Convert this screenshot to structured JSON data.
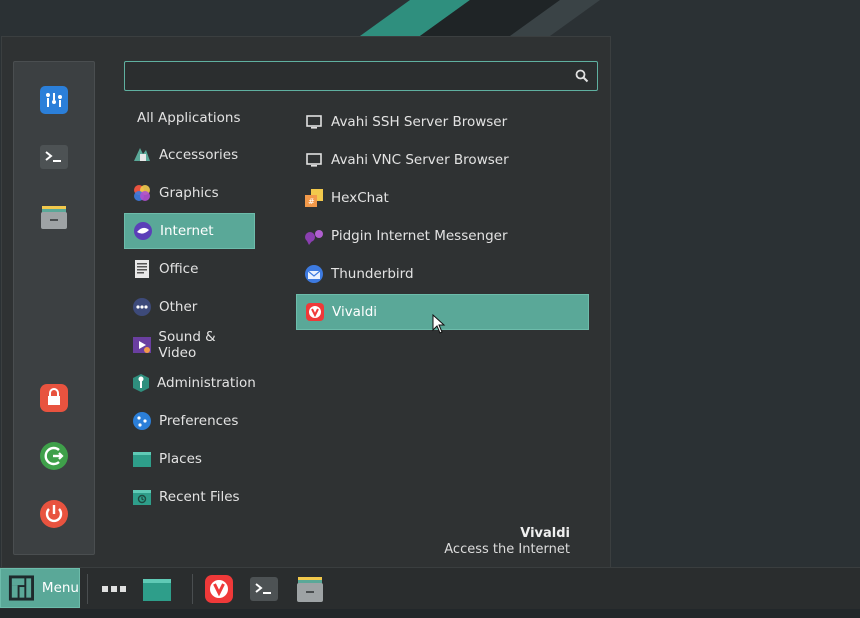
{
  "search": {
    "value": "",
    "placeholder": ""
  },
  "categories": [
    {
      "label": "All Applications"
    },
    {
      "label": "Accessories"
    },
    {
      "label": "Graphics"
    },
    {
      "label": "Internet"
    },
    {
      "label": "Office"
    },
    {
      "label": "Other"
    },
    {
      "label": "Sound & Video"
    },
    {
      "label": "Administration"
    },
    {
      "label": "Preferences"
    },
    {
      "label": "Places"
    },
    {
      "label": "Recent Files"
    }
  ],
  "apps": [
    {
      "label": "Avahi SSH Server Browser"
    },
    {
      "label": "Avahi VNC Server Browser"
    },
    {
      "label": "HexChat"
    },
    {
      "label": "Pidgin Internet Messenger"
    },
    {
      "label": "Thunderbird"
    },
    {
      "label": "Vivaldi"
    }
  ],
  "selected_category": "Internet",
  "selected_app": "Vivaldi",
  "description": {
    "title": "Vivaldi",
    "subtitle": "Access the Internet"
  },
  "panel": {
    "menu_label": "Menu"
  },
  "colors": {
    "accent": "#5aa898",
    "danger": "#e8533f",
    "menu_bg": "#2f3233"
  },
  "icons": {
    "sidebar": [
      "settings-manager-icon",
      "terminal-icon",
      "file-manager-icon",
      "lock-icon",
      "logout-icon",
      "power-icon"
    ],
    "panel": [
      "manjaro-menu-icon",
      "show-applications-icon",
      "show-desktop-icon",
      "vivaldi-icon",
      "terminal-icon",
      "file-manager-icon"
    ]
  }
}
